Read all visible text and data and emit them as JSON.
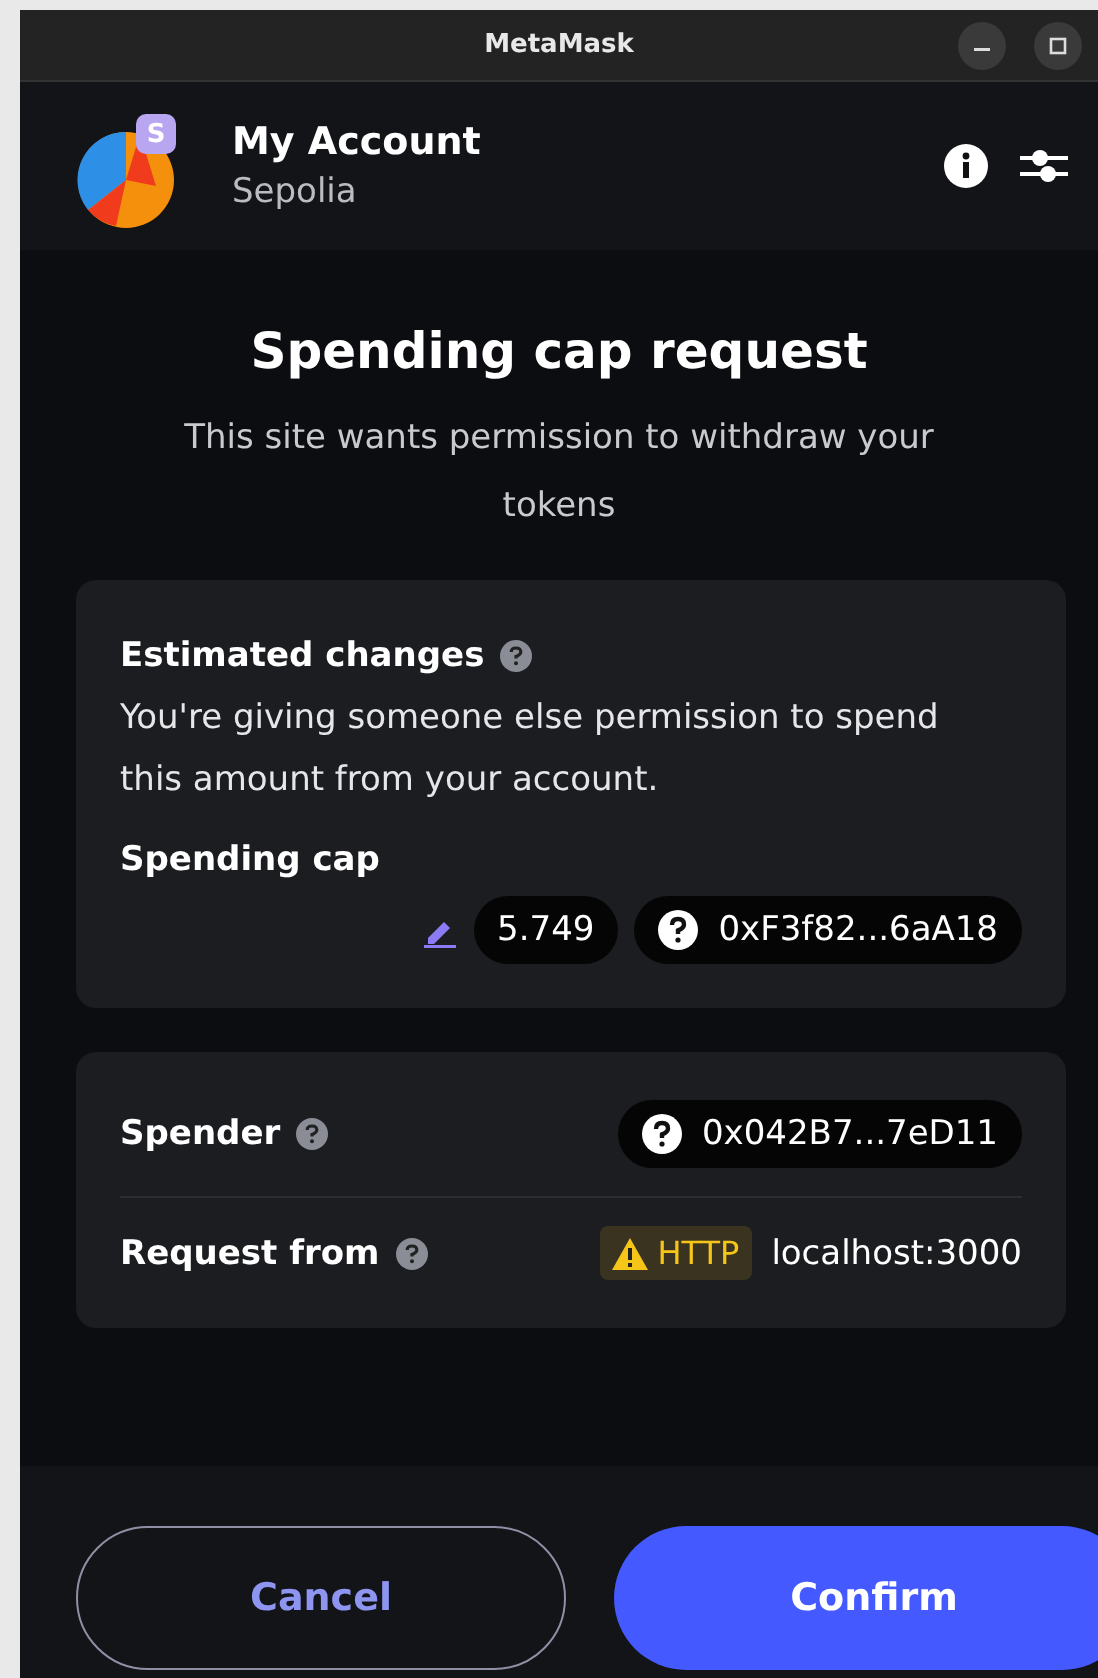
{
  "window": {
    "title": "MetaMask"
  },
  "account": {
    "name": "My Account",
    "network": "Sepolia",
    "network_badge": "S"
  },
  "title": "Spending cap request",
  "subtitle": "This site wants permission to withdraw your tokens",
  "estimated_changes": {
    "heading": "Estimated changes",
    "description": "You're giving someone else permission to spend this amount from your account.",
    "label": "Spending cap",
    "amount": "5.749",
    "token": "0xF3f82...6aA18"
  },
  "details": [
    {
      "kind": "address",
      "label": "Spender",
      "value": "0x042B7...7eD11"
    },
    {
      "kind": "origin",
      "label": "Request from",
      "badge": "HTTP",
      "value": "localhost:3000"
    }
  ],
  "buttons": [
    {
      "label": "Cancel",
      "kind": "secondary"
    },
    {
      "label": "Confirm",
      "kind": "primary"
    }
  ]
}
